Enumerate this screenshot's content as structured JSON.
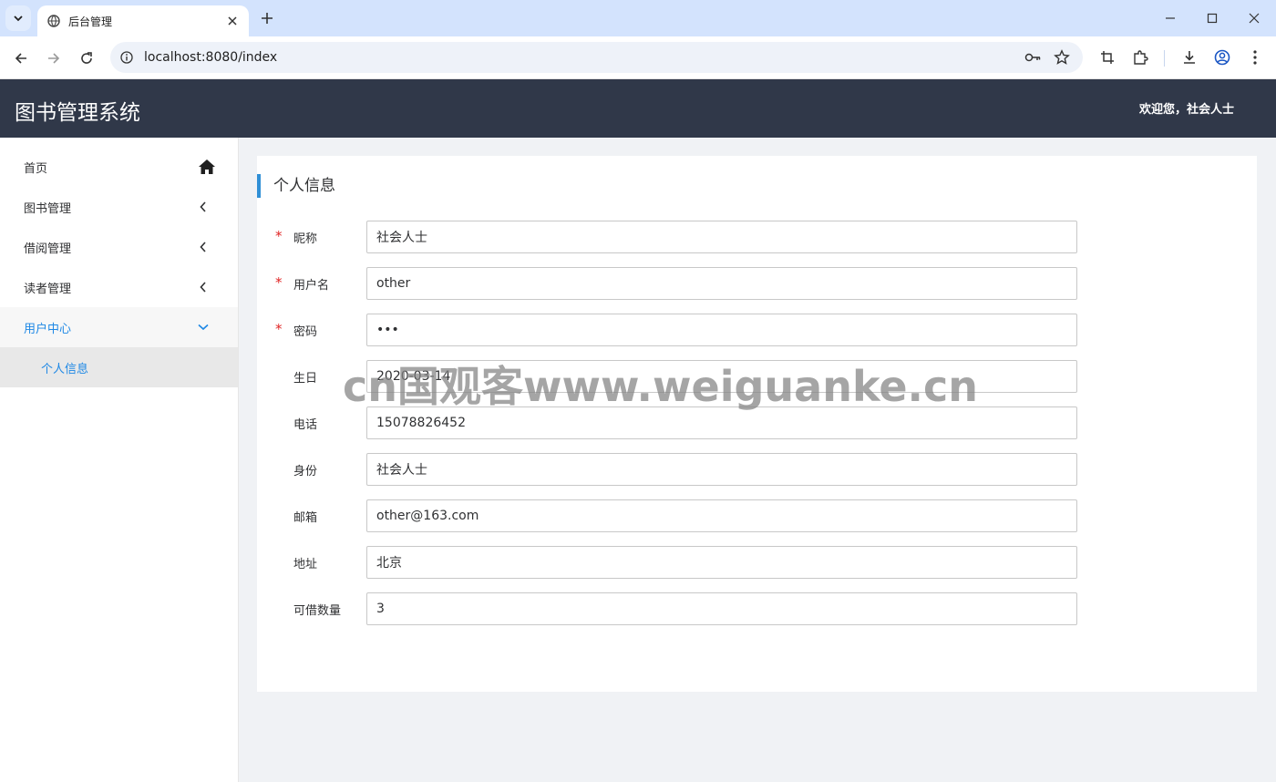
{
  "browser": {
    "tab_title": "后台管理",
    "url": "localhost:8080/index"
  },
  "header": {
    "app_title": "图书管理系统",
    "welcome": "欢迎您，社会人士"
  },
  "sidebar": {
    "items": [
      {
        "label": "首页"
      },
      {
        "label": "图书管理"
      },
      {
        "label": "借阅管理"
      },
      {
        "label": "读者管理"
      },
      {
        "label": "用户中心"
      }
    ],
    "subitems": [
      {
        "label": "个人信息"
      }
    ]
  },
  "main": {
    "card_title": "个人信息",
    "fields": [
      {
        "label": "昵称",
        "value": "社会人士",
        "required": true
      },
      {
        "label": "用户名",
        "value": "other",
        "required": true
      },
      {
        "label": "密码",
        "value": "•••",
        "required": true
      },
      {
        "label": "生日",
        "value": "2020-03-14",
        "required": false
      },
      {
        "label": "电话",
        "value": "15078826452",
        "required": false
      },
      {
        "label": "身份",
        "value": "社会人士",
        "required": false
      },
      {
        "label": "邮箱",
        "value": "other@163.com",
        "required": false
      },
      {
        "label": "地址",
        "value": "北京",
        "required": false
      },
      {
        "label": "可借数量",
        "value": "3",
        "required": false
      }
    ],
    "required_mark": "*"
  },
  "watermark": "cn国观客www.weiguanke.cn",
  "colors": {
    "header_bg": "#303849",
    "accent": "#1e88e5",
    "required": "#e02424"
  }
}
